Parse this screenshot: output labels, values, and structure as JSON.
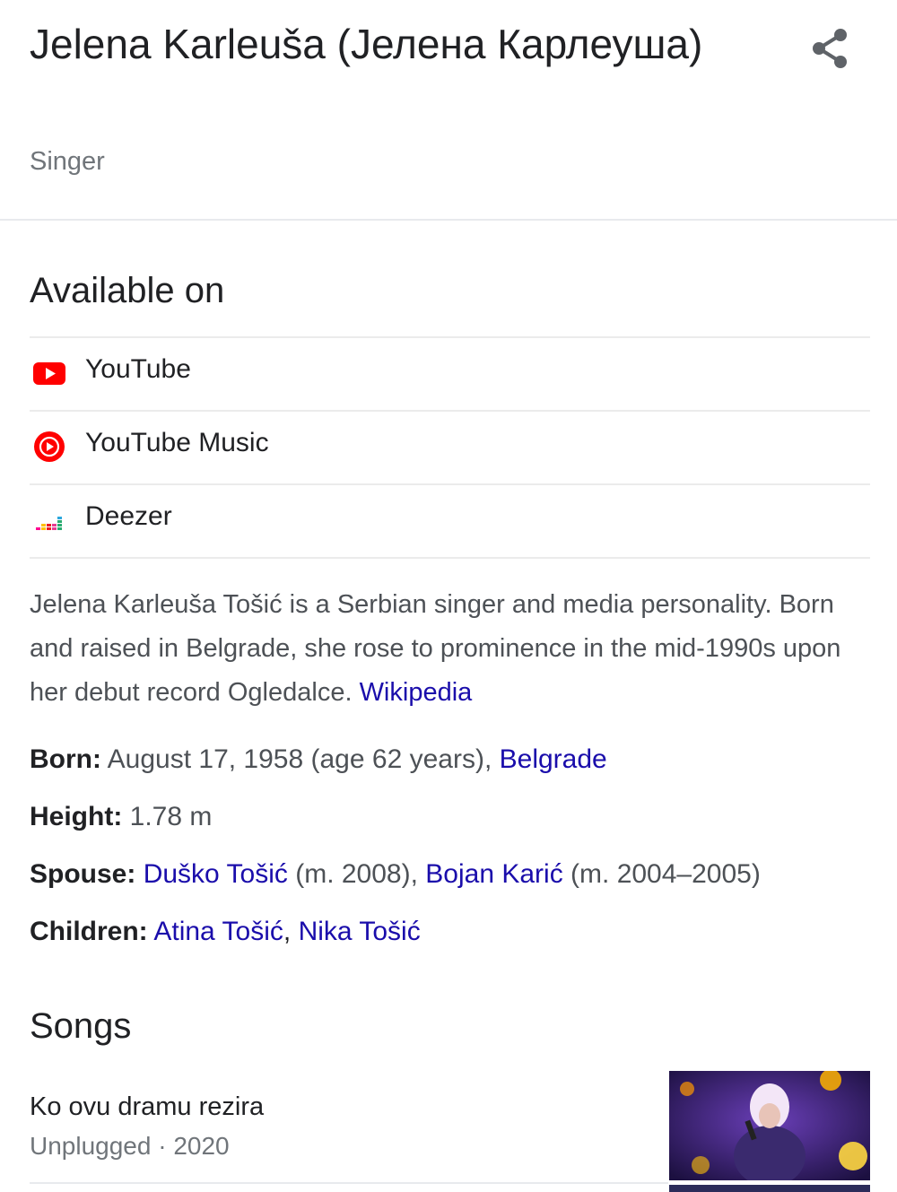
{
  "header": {
    "title": "Jelena Karleuša (Јелена Карлеуша)",
    "subtitle": "Singer"
  },
  "available": {
    "heading": "Available on",
    "items": [
      {
        "label": "YouTube",
        "icon": "youtube-icon"
      },
      {
        "label": "YouTube Music",
        "icon": "youtube-music-icon"
      },
      {
        "label": "Deezer",
        "icon": "deezer-icon"
      }
    ]
  },
  "description": {
    "text": "Jelena Karleuša Tošić is a Serbian singer and media personality. Born and raised in Belgrade, she rose to prominence in the mid-1990s upon her debut record Ogledalce. ",
    "source": "Wikipedia"
  },
  "facts": {
    "born": {
      "label": "Born:",
      "value": " August 17, 1958 (age 62 years), ",
      "link": "Belgrade"
    },
    "height": {
      "label": "Height:",
      "value": " 1.78 m"
    },
    "spouse": {
      "label": "Spouse:",
      "link1": "Duško Tošić",
      "value1": " (m. 2008), ",
      "link2": "Bojan Karić",
      "value2": " (m. 2004–2005)"
    },
    "children": {
      "label": "Children:",
      "link1": "Atina Tošić",
      "sep": ", ",
      "link2": "Nika Tošić"
    }
  },
  "songs": {
    "heading": "Songs",
    "items": [
      {
        "title": "Ko ovu dramu rezira",
        "subtitle": "Unplugged · 2020"
      }
    ]
  },
  "colors": {
    "link": "#1a0dab",
    "youtube_red": "#ff0000",
    "text": "#202124",
    "secondary": "#70757a"
  }
}
